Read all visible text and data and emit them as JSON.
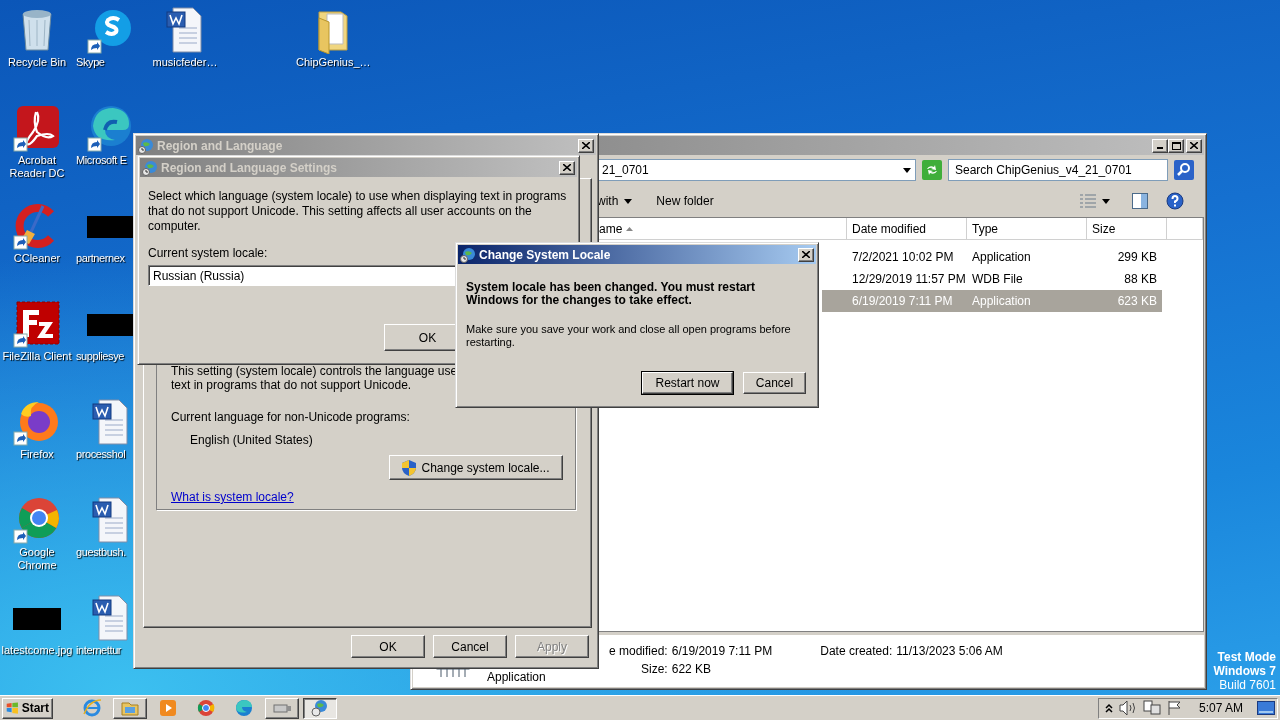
{
  "desktop_icons": [
    {
      "label": "Recycle Bin",
      "kind": "recycle",
      "shortcut": false
    },
    {
      "label": "Skype",
      "kind": "skype",
      "shortcut": true
    },
    {
      "label": "musicfeder…",
      "kind": "word",
      "shortcut": false
    },
    {
      "label": "ChipGenius_…",
      "kind": "folder",
      "shortcut": false
    },
    {
      "label": "Acrobat Reader DC",
      "kind": "acrobat",
      "shortcut": true
    },
    {
      "label": "Microsoft E",
      "kind": "edge",
      "shortcut": true
    },
    {
      "label": "CCleaner",
      "kind": "ccleaner",
      "shortcut": true
    },
    {
      "label": "partnernex",
      "kind": "thumb",
      "shortcut": false
    },
    {
      "label": "FileZilla Client",
      "kind": "filezilla",
      "shortcut": true
    },
    {
      "label": "suppliesye",
      "kind": "thumb",
      "shortcut": false
    },
    {
      "label": "Firefox",
      "kind": "firefox",
      "shortcut": true
    },
    {
      "label": "processhol",
      "kind": "word",
      "shortcut": false
    },
    {
      "label": "Google Chrome",
      "kind": "chrome",
      "shortcut": true
    },
    {
      "label": "guestbush.",
      "kind": "word",
      "shortcut": false
    },
    {
      "label": "latestcome.jpg",
      "kind": "thumb",
      "shortcut": false
    },
    {
      "label": "internettur",
      "kind": "word",
      "shortcut": false
    }
  ],
  "explorer": {
    "active": false,
    "address": "21_0701",
    "search": {
      "placeholder": "Search ChipGenius_v4_21_0701"
    },
    "toolbar": [
      "with",
      "New folder"
    ],
    "columns": [
      "ame",
      "Date modified",
      "Type",
      "Size"
    ],
    "rows": [
      {
        "date": "7/2/2021 10:02 PM",
        "type": "Application",
        "size": "299 KB",
        "selected": false
      },
      {
        "date": "12/29/2019 11:57 PM",
        "type": "WDB File",
        "size": "88 KB",
        "selected": false
      },
      {
        "date": "6/19/2019 7:11 PM",
        "type": "Application",
        "size": "623 KB",
        "selected": true
      }
    ],
    "details": {
      "type": "Application",
      "fields": [
        {
          "label": "e modified:",
          "value": "6/19/2019 7:11 PM"
        },
        {
          "label": "Date created:",
          "value": "11/13/2023 5:06 AM"
        },
        {
          "label": "Size:",
          "value": "622 KB"
        }
      ]
    }
  },
  "region_window": {
    "title": "Region and Language",
    "active": false,
    "note_lines": [
      "This setting (system locale) controls the language use",
      "text in programs that do not support Unicode."
    ],
    "current_label": "Current language for non-Unicode programs:",
    "current_value": "English (United States)",
    "change_button": "Change system locale...",
    "link": "What is system locale?",
    "buttons": [
      {
        "label": "OK",
        "disabled": false
      },
      {
        "label": "Cancel",
        "disabled": false
      },
      {
        "label": "Apply",
        "disabled": true
      }
    ]
  },
  "settings_dialog": {
    "title": "Region and Language Settings",
    "active": false,
    "message": "Select which language (system locale) to use when displaying text in programs that do not support Unicode. This setting affects all user accounts on the computer.",
    "locale_label": "Current system locale:",
    "locale_value": "Russian (Russia)",
    "buttons": [
      {
        "label": "OK",
        "default": false
      }
    ]
  },
  "locale_dialog": {
    "title": "Change System Locale",
    "active": true,
    "message": "System locale has been changed. You must restart Windows for the changes to take effect.",
    "note": "Make sure you save your work and close all open programs before restarting.",
    "buttons": [
      {
        "label": "Restart now",
        "default": true
      },
      {
        "label": "Cancel",
        "default": false
      }
    ]
  },
  "test_mode": [
    "Test Mode",
    "Windows 7",
    "Build 7601"
  ],
  "taskbar": {
    "start": "Start",
    "apps": [
      {
        "kind": "ie",
        "running": false,
        "selected": false
      },
      {
        "kind": "explorer",
        "running": true,
        "selected": false
      },
      {
        "kind": "media",
        "running": false,
        "selected": false
      },
      {
        "kind": "chrome",
        "running": false,
        "selected": false
      },
      {
        "kind": "edge",
        "running": false,
        "selected": false
      },
      {
        "kind": "usb",
        "running": true,
        "selected": false
      },
      {
        "kind": "region",
        "running": true,
        "selected": true
      }
    ],
    "clock": "5:07 AM"
  }
}
